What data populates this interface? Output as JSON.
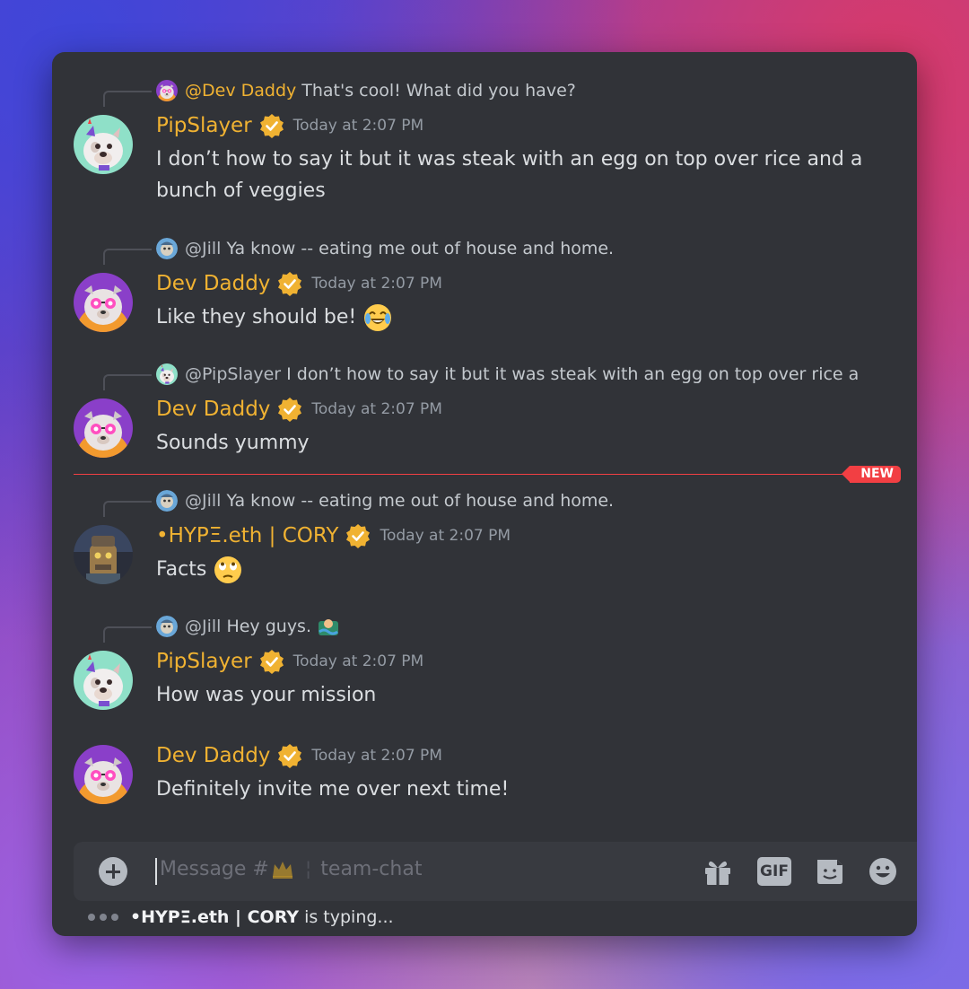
{
  "channel": {
    "placeholder_prefix": "Message #",
    "name": "team-chat"
  },
  "new_marker": "NEW",
  "messages": [
    {
      "reply": {
        "name": "@Dev Daddy",
        "text": "That's cool! What did you have?"
      },
      "author": "PipSlayer",
      "time": "Today at 2:07 PM",
      "lines": [
        "I don’t how to say it but it was steak with an egg on top over rice and a",
        "bunch of veggies"
      ]
    },
    {
      "reply": {
        "name": "@Jill",
        "text": "Ya know -- eating me out of house and home."
      },
      "author": "Dev Daddy",
      "time": "Today at 2:07 PM",
      "text": "Like they should be!",
      "emoji": "joy-emoji"
    },
    {
      "reply": {
        "name": "@PipSlayer",
        "text": "I don’t how to say it but it was steak with an egg on top over rice a"
      },
      "author": "Dev Daddy",
      "time": "Today at 2:07 PM",
      "text": "Sounds yummy"
    },
    {
      "reply": {
        "name": "@Jill",
        "text": "Ya know -- eating me out of house and home."
      },
      "author": "•HYPΞ.eth | CORY",
      "time": "Today at 2:07 PM",
      "text": "Facts",
      "emoji": "eye-roll-emoji"
    },
    {
      "reply": {
        "name": "@Jill",
        "text": "Hey guys."
      },
      "author": "PipSlayer",
      "time": "Today at 2:07 PM",
      "text": "How was your mission"
    },
    {
      "author": "Dev Daddy",
      "time": "Today at 2:07 PM",
      "text": "Definitely invite me over next time!"
    }
  ],
  "typing": {
    "user": "•HYPΞ.eth | CORY",
    "suffix": "is typing..."
  },
  "toolbar": {
    "gif_label": "GIF"
  },
  "colors": {
    "background": "#313338",
    "author": "#f0b232",
    "new_marker": "#f23f43"
  }
}
